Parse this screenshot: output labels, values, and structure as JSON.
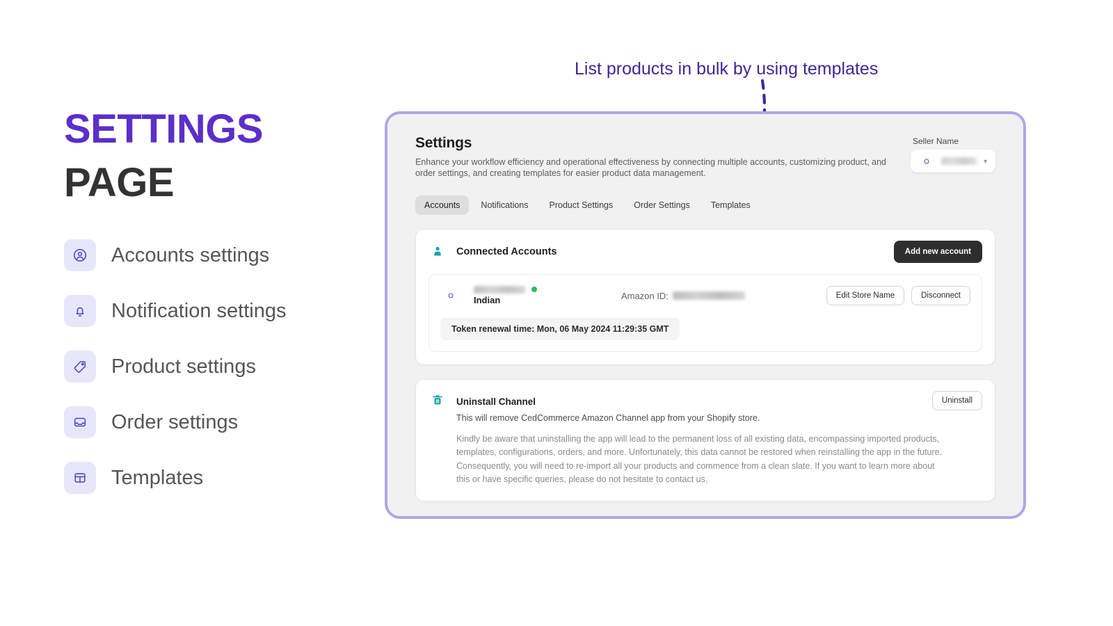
{
  "left": {
    "title_line1": "SETTINGS",
    "title_line2": "PAGE",
    "nav": [
      {
        "label": "Accounts settings",
        "icon": "user-circle-icon"
      },
      {
        "label": "Notification settings",
        "icon": "bell-icon"
      },
      {
        "label": "Product settings",
        "icon": "tag-icon"
      },
      {
        "label": "Order settings",
        "icon": "inbox-icon"
      },
      {
        "label": "Templates",
        "icon": "template-icon"
      }
    ]
  },
  "annotation": {
    "text": "List products in bulk by using templates",
    "color": "#3b2a99"
  },
  "panel": {
    "title": "Settings",
    "subtitle": "Enhance your workflow efficiency and operational effectiveness by connecting multiple accounts, customizing product, and order settings, and creating templates for easier product data management.",
    "seller": {
      "label": "Seller Name",
      "name": "████████",
      "caret": "▼"
    },
    "tabs": [
      {
        "label": "Accounts",
        "active": true
      },
      {
        "label": "Notifications",
        "active": false
      },
      {
        "label": "Product Settings",
        "active": false
      },
      {
        "label": "Order Settings",
        "active": false
      },
      {
        "label": "Templates",
        "active": false
      }
    ],
    "connected_accounts": {
      "heading": "Connected Accounts",
      "add_button": "Add new account",
      "account": {
        "store_name": "████████",
        "status": "online",
        "country": "Indian",
        "amazon_id_label": "Amazon ID:",
        "amazon_id_value": "███████████",
        "edit_button": "Edit Store Name",
        "disconnect_button": "Disconnect",
        "token_renewal": "Token renewal time: Mon, 06 May 2024 11:29:35 GMT"
      }
    },
    "uninstall": {
      "heading": "Uninstall Channel",
      "button": "Uninstall",
      "line": "This will remove CedCommerce Amazon Channel app from your Shopify store.",
      "paragraph": "Kindly be aware that uninstalling the app will lead to the permanent loss of all existing data, encompassing imported products, templates, configurations, orders, and more. Unfortunately, this data cannot be restored when reinstalling the app in the future. Consequently, you will need to re-import all your products and commence from a clean slate. If you want to learn more about this or have specific queries, please do not hesitate to contact us."
    }
  },
  "colors": {
    "accent_purple": "#5b2fc9",
    "panel_border": "#b0a7e4",
    "icon_tile": "#e7e6fb",
    "icon_stroke": "#4f46c9",
    "teal": "#1aa5a5",
    "status_green": "#2dbd5c"
  }
}
